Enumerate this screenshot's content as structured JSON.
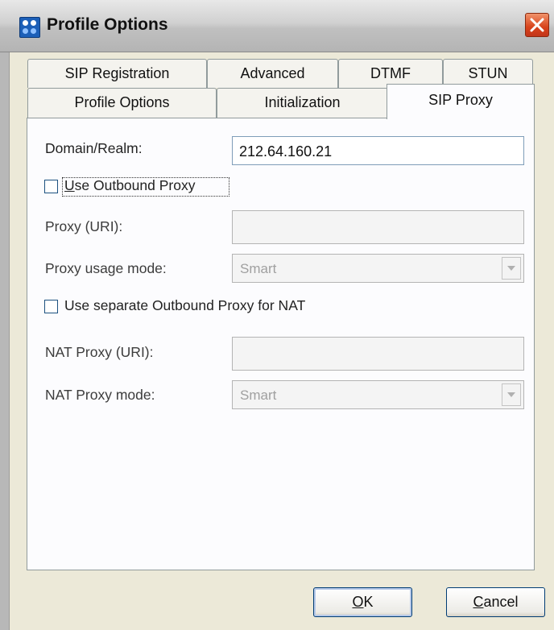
{
  "window": {
    "title": "Profile Options"
  },
  "tabs": {
    "row1": [
      {
        "label": "SIP Registration"
      },
      {
        "label": "Advanced"
      },
      {
        "label": "DTMF"
      },
      {
        "label": "STUN"
      }
    ],
    "row2": [
      {
        "label": "Profile Options"
      },
      {
        "label": "Initialization"
      },
      {
        "label": "SIP Proxy",
        "active": true
      }
    ]
  },
  "form": {
    "domain_label": "Domain/Realm:",
    "domain_value": "212.64.160.21",
    "use_outbound_proxy_label": "Use Outbound Proxy",
    "use_outbound_proxy_checked": false,
    "proxy_uri_label": "Proxy (URI):",
    "proxy_uri_value": "",
    "proxy_usage_mode_label": "Proxy usage mode:",
    "proxy_usage_mode_value": "Smart",
    "use_separate_nat_label": "Use separate Outbound Proxy for NAT",
    "use_separate_nat_checked": false,
    "nat_proxy_uri_label": "NAT Proxy (URI):",
    "nat_proxy_uri_value": "",
    "nat_proxy_mode_label": "NAT Proxy mode:",
    "nat_proxy_mode_value": "Smart"
  },
  "buttons": {
    "ok_label": "OK",
    "cancel_label": "Cancel"
  },
  "icons": {
    "app": "app-profile-icon",
    "close": "close-icon",
    "dropdown": "chevron-down-icon"
  },
  "colors": {
    "close_button": "#d8431b",
    "app_icon": "#1c5fb8",
    "dialog_bg": "#ece9d8",
    "panel_bg": "#fcfcfe"
  }
}
